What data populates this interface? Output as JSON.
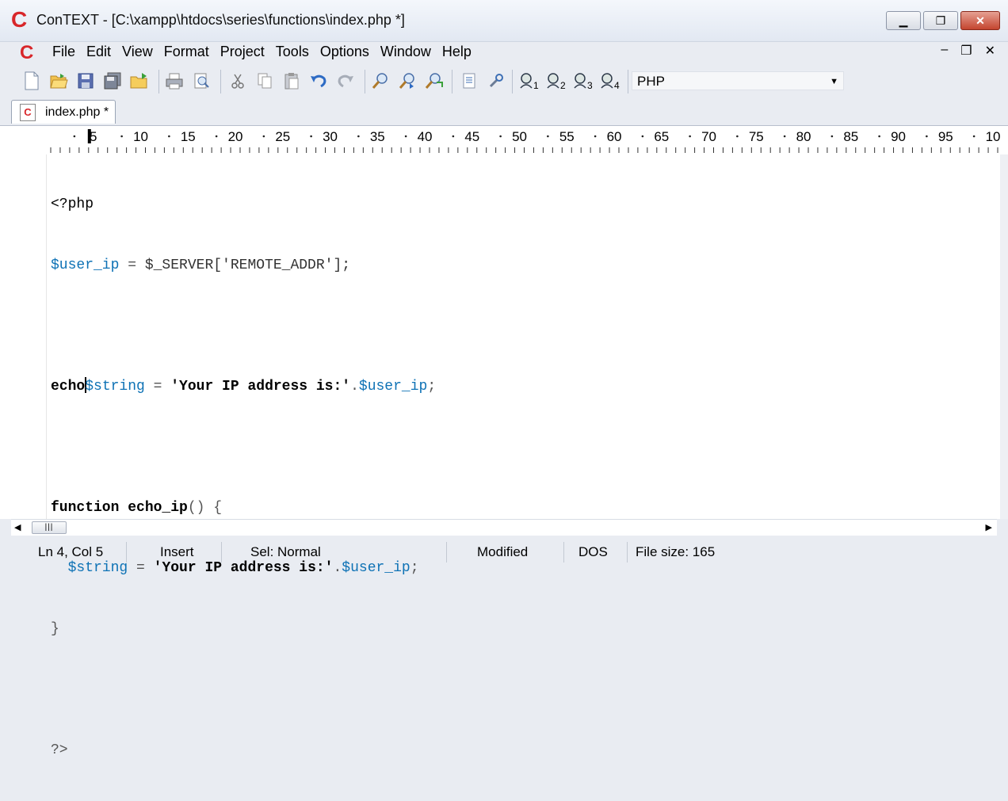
{
  "window": {
    "title": "ConTEXT - [C:\\xampp\\htdocs\\series\\functions\\index.php *]",
    "logo": "C",
    "minimize": "▁",
    "maximize": "❐",
    "close": "✕"
  },
  "menu": {
    "items": [
      "File",
      "Edit",
      "View",
      "Format",
      "Project",
      "Tools",
      "Options",
      "Window",
      "Help"
    ],
    "mdi_min": "–",
    "mdi_restore": "❐",
    "mdi_close": "✕"
  },
  "toolbar": {
    "language": "PHP",
    "icons": [
      "new-file-icon",
      "open-folder-icon",
      "save-icon",
      "save-all-icon",
      "open-folder-alt-icon",
      "print-icon",
      "print-preview-icon",
      "cut-icon",
      "copy-icon",
      "paste-icon",
      "undo-icon",
      "redo-icon",
      "find-icon",
      "find-next-icon",
      "replace-icon",
      "options-icon",
      "tools-icon",
      "user-exec-1-icon",
      "user-exec-2-icon",
      "user-exec-3-icon",
      "user-exec-4-icon"
    ],
    "user_exec_numbers": [
      "1",
      "2",
      "3",
      "4"
    ]
  },
  "tab": {
    "label": "index.php *",
    "icon_letter": "C"
  },
  "ruler": {
    "labels": [
      "5",
      "10",
      "15",
      "20",
      "25",
      "30",
      "35",
      "40",
      "45",
      "50",
      "55",
      "60",
      "65",
      "70",
      "75",
      "80",
      "85",
      "90",
      "95",
      "10"
    ]
  },
  "code": {
    "line1": "<?php",
    "line2_var": "$user_ip",
    "line2_eq": " = ",
    "line2_rest": "$_SERVER['REMOTE_ADDR'];",
    "line4_kw": "echo",
    "line4_var": "$string",
    "line4_eq": " = ",
    "line4_str": "'Your IP address is:'",
    "line4_dot": ".",
    "line4_var2": "$user_ip",
    "line4_end": ";",
    "line6_kw": "function",
    "line6_name": " echo_ip",
    "line6_paren": "() {",
    "line7_indent": "  ",
    "line7_var": "$string",
    "line7_eq": " = ",
    "line7_str": "'Your IP address is:'",
    "line7_dot": ".",
    "line7_var2": "$user_ip",
    "line7_end": ";",
    "line8": "}",
    "line10": "?>"
  },
  "hscroll": {
    "left": "◀",
    "thumb": "|||",
    "right": "▶"
  },
  "status": {
    "position": "Ln 4, Col 5",
    "mode": "Insert",
    "selection": "Sel: Normal",
    "modified": "Modified",
    "line_endings": "DOS",
    "file_size": "File size: 165"
  },
  "colors": {
    "variable": "#0e72b5",
    "logo_red": "#d8262a",
    "background": "#e9ecf2"
  }
}
